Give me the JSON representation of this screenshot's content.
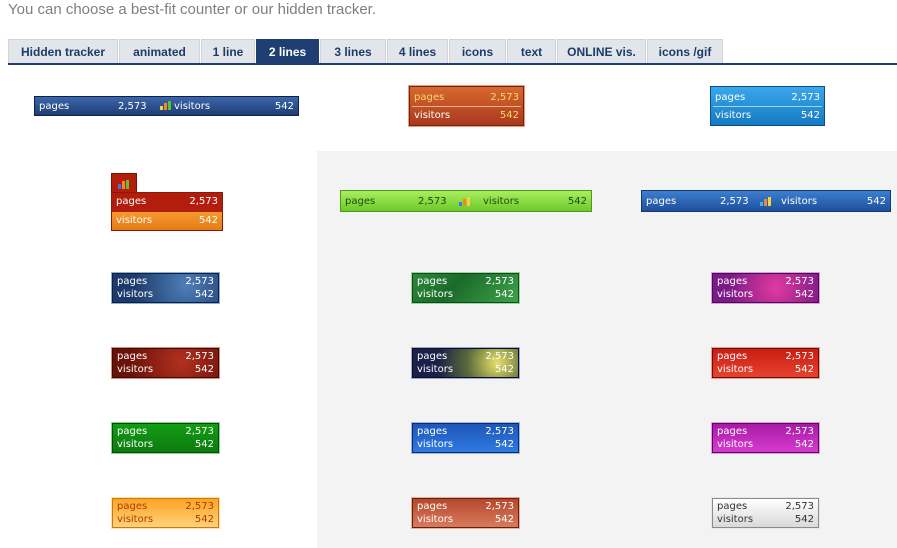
{
  "intro": "You can choose a best-fit counter or our hidden tracker.",
  "tabs": [
    {
      "label": "Hidden tracker",
      "active": false
    },
    {
      "label": "animated",
      "active": false
    },
    {
      "label": "1 line",
      "active": false
    },
    {
      "label": "2 lines",
      "active": true
    },
    {
      "label": "3 lines",
      "active": false
    },
    {
      "label": "4 lines",
      "active": false
    },
    {
      "label": "icons",
      "active": false
    },
    {
      "label": "text",
      "active": false
    },
    {
      "label": "ONLINE vis.",
      "active": false
    },
    {
      "label": "icons /gif",
      "active": false
    }
  ],
  "counter": {
    "pages_label": "pages",
    "pages_value": "2,573",
    "visitors_label": "visitors",
    "visitors_value": "542"
  },
  "styles": {
    "navy_textured": {
      "bg": "#2a4d8a",
      "text": "#ffffff"
    },
    "orange_rust": {
      "bg": "#c4552a",
      "text_top": "#ffd66b",
      "text_bottom": "#ffffff"
    },
    "sky_blue": {
      "bg": "#1f8fd6",
      "text": "#ffffff"
    },
    "red_orange": {
      "bg": "#b31e0c",
      "bg2": "#f08a24",
      "text": "#ffffff"
    },
    "lime_green": {
      "bg": "#7dd63c",
      "text": "#1e4b0f"
    },
    "royal_blue": {
      "bg": "#2f6ec0",
      "text": "#ffffff"
    },
    "green": {
      "bg": "#1f9a1f",
      "text": "#ffffff"
    },
    "magenta": {
      "bg": "#b52bb0",
      "text": "#ffffff"
    },
    "gold": {
      "bg": "#ffb230",
      "text": "#a33a00"
    },
    "silver": {
      "bg": "#f0f0f0",
      "text": "#333333"
    }
  }
}
